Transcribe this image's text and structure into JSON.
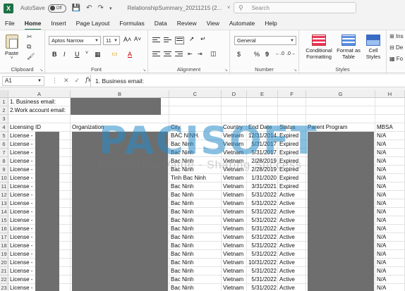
{
  "title_bar": {
    "autosave_label": "AutoSave",
    "autosave_state": "Off",
    "filename": "RelationshipSummary_20211215 (2...",
    "search_placeholder": "Search"
  },
  "tabs": [
    "File",
    "Home",
    "Insert",
    "Page Layout",
    "Formulas",
    "Data",
    "Review",
    "View",
    "Automate",
    "Help"
  ],
  "active_tab": "Home",
  "ribbon": {
    "clipboard": {
      "paste": "Paste",
      "label": "Clipboard"
    },
    "font": {
      "name": "Aptos Narrow",
      "size": "11",
      "label": "Font",
      "bold": "B",
      "italic": "I",
      "underline": "U",
      "grow": "A˄",
      "shrink": "A˅",
      "font_color": "A"
    },
    "alignment": {
      "label": "Alignment"
    },
    "number": {
      "format": "General",
      "label": "Number",
      "currency": "$",
      "percent": "%",
      "comma": "9"
    },
    "styles": {
      "conditional": "Conditional Formatting",
      "format_table": "Format as Table",
      "cell_styles": "Cell Styles",
      "label": "Styles"
    },
    "cells_partial": [
      "Ins",
      "De",
      "Fo"
    ]
  },
  "formula_bar": {
    "name_box": "A1",
    "fx": "fx",
    "content": "1. Business email:"
  },
  "columns": [
    "A",
    "B",
    "C",
    "D",
    "E",
    "F",
    "G",
    "H"
  ],
  "row_numbers": [
    "1",
    "2",
    "3",
    "4",
    "5",
    "6",
    "7",
    "8",
    "9",
    "10",
    "11",
    "12",
    "13",
    "14",
    "15",
    "16",
    "17",
    "18",
    "19",
    "20",
    "21",
    "22",
    "23"
  ],
  "sheet": {
    "row1": "1. Business email:",
    "row2": "2.Work account email:",
    "headers": {
      "a": "Licensing ID",
      "b": "Organization",
      "c": "City",
      "d": "Country",
      "e": "End Date",
      "f": "Status",
      "g": "Parent Program",
      "h": "MBSA"
    },
    "rows": [
      {
        "a": "License -",
        "c": "BAC NINH.",
        "d": "Vietnam",
        "e": "12/31/2014",
        "f": "Expired",
        "h": "N/A"
      },
      {
        "a": "License -",
        "c": "Bac Ninh",
        "d": "Vietnam",
        "e": "5/31/2017",
        "f": "Expired",
        "h": "N/A"
      },
      {
        "a": "License -",
        "c": "Bac Ninh",
        "d": "Vietnam",
        "e": "5/31/2017",
        "f": "Expired",
        "h": "N/A"
      },
      {
        "a": "License -",
        "c": "Bac Ninh",
        "d": "Vietnam",
        "e": "2/28/2019",
        "f": "Expired",
        "h": "N/A"
      },
      {
        "a": "License -",
        "c": "Bac Ninh",
        "d": "Vietnam",
        "e": "2/28/2019",
        "f": "Expired",
        "h": "N/A"
      },
      {
        "a": "License -",
        "c": "Tinh Bac Ninh",
        "d": "Vietnam",
        "e": "1/31/2020",
        "f": "Expired",
        "h": "N/A"
      },
      {
        "a": "License -",
        "c": "Bac Ninh",
        "d": "Vietnam",
        "e": "3/31/2021",
        "f": "Expired",
        "h": "N/A"
      },
      {
        "a": "License -",
        "c": "Bac Ninh",
        "d": "Vietnam",
        "e": "5/31/2022",
        "f": "Active",
        "h": "N/A"
      },
      {
        "a": "License -",
        "c": "Bac Ninh",
        "d": "Vietnam",
        "e": "5/31/2022",
        "f": "Active",
        "h": "N/A"
      },
      {
        "a": "License -",
        "c": "Bac Ninh",
        "d": "Vietnam",
        "e": "5/31/2022",
        "f": "Active",
        "h": "N/A"
      },
      {
        "a": "License -",
        "c": "Bac Ninh",
        "d": "Vietnam",
        "e": "5/31/2022",
        "f": "Active",
        "h": "N/A"
      },
      {
        "a": "License -",
        "c": "Bac Ninh",
        "d": "Vietnam",
        "e": "5/31/2022",
        "f": "Active",
        "h": "N/A"
      },
      {
        "a": "License -",
        "c": "Bac Ninh",
        "d": "Vietnam",
        "e": "5/31/2022",
        "f": "Active",
        "h": "N/A"
      },
      {
        "a": "License -",
        "c": "Bac Ninh",
        "d": "Vietnam",
        "e": "5/31/2022",
        "f": "Active",
        "h": "N/A"
      },
      {
        "a": "License -",
        "c": "Bac Ninh",
        "d": "Vietnam",
        "e": "5/31/2022",
        "f": "Active",
        "h": "N/A"
      },
      {
        "a": "License -",
        "c": "Bac Ninh",
        "d": "Vietnam",
        "e": "10/31/2022",
        "f": "Active",
        "h": "N/A"
      },
      {
        "a": "License -",
        "c": "Bac Ninh",
        "d": "Vietnam",
        "e": "5/31/2022",
        "f": "Active",
        "h": "N/A"
      },
      {
        "a": "License -",
        "c": "Bac Ninh",
        "d": "Vietnam",
        "e": "5/31/2022",
        "f": "Active",
        "h": "N/A"
      },
      {
        "a": "License -",
        "c": "Bac Ninh",
        "d": "Vietnam",
        "e": "5/31/2022",
        "f": "Active",
        "h": "N/A"
      }
    ]
  },
  "watermark": {
    "brand": "PACISOFT",
    "tagline": "Optimizing Value · Sharing Success"
  },
  "colors": {
    "excel_green": "#1e7145",
    "redaction": "#6e6e6e",
    "watermark": "#288cc8"
  }
}
